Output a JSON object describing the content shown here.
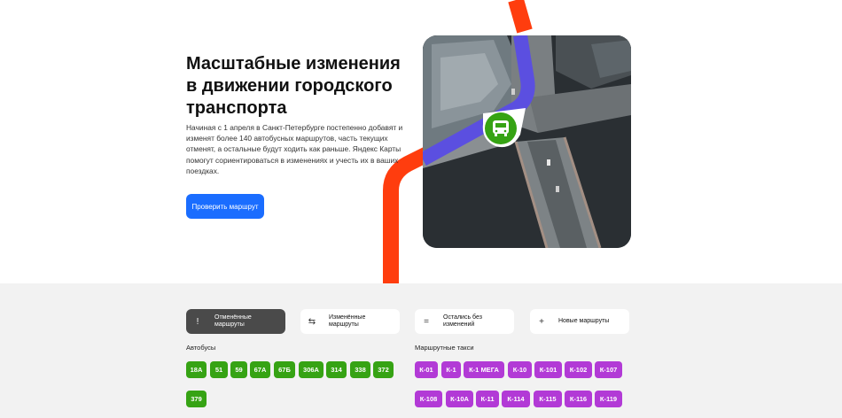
{
  "hero": {
    "title": "Масштабные изменения в движении городского транспорта",
    "description": "Начиная с 1 апреля в Санкт-Петербурге постепенно добавят и изменят более 140 автобусных маршрутов, часть текущих отменят, а остальные будут ходить как раньше. Яндекс Карты помогут сориентироваться в изменениях и учесть их в ваших поездках.",
    "cta_label": "Проверить маршрут"
  },
  "colors": {
    "accent": "#1a6dff",
    "route_line": "#ff3d0e",
    "bus_route": "#5b4fe0",
    "bus_chip": "#36a314",
    "taxi_chip": "#b23ad6",
    "active_tab": "#4a4a4a"
  },
  "tabs": [
    {
      "label": "Отменённые\nмаршруты",
      "icon": "exclamation-icon",
      "glyph": "!",
      "active": true
    },
    {
      "label": "Изменённые\nмаршруты",
      "icon": "swap-arrows-icon",
      "glyph": "⇆",
      "active": false
    },
    {
      "label": "Остались без\nизменений",
      "icon": "equals-icon",
      "glyph": "=",
      "active": false
    },
    {
      "label": "Новые маршруты",
      "icon": "plus-icon",
      "glyph": "+",
      "active": false
    }
  ],
  "buses": {
    "label": "Автобусы",
    "routes": [
      "18А",
      "51",
      "59",
      "67А",
      "67Б",
      "306А",
      "314",
      "338",
      "372",
      "379"
    ]
  },
  "taxis": {
    "label": "Маршрутные такси",
    "routes": [
      "К-01",
      "К-1",
      "К-1 МЕГА",
      "К-10",
      "К-101",
      "К-102",
      "К-107",
      "К-108",
      "К-10А",
      "К-11",
      "К-114",
      "К-115",
      "К-116",
      "К-119"
    ]
  }
}
